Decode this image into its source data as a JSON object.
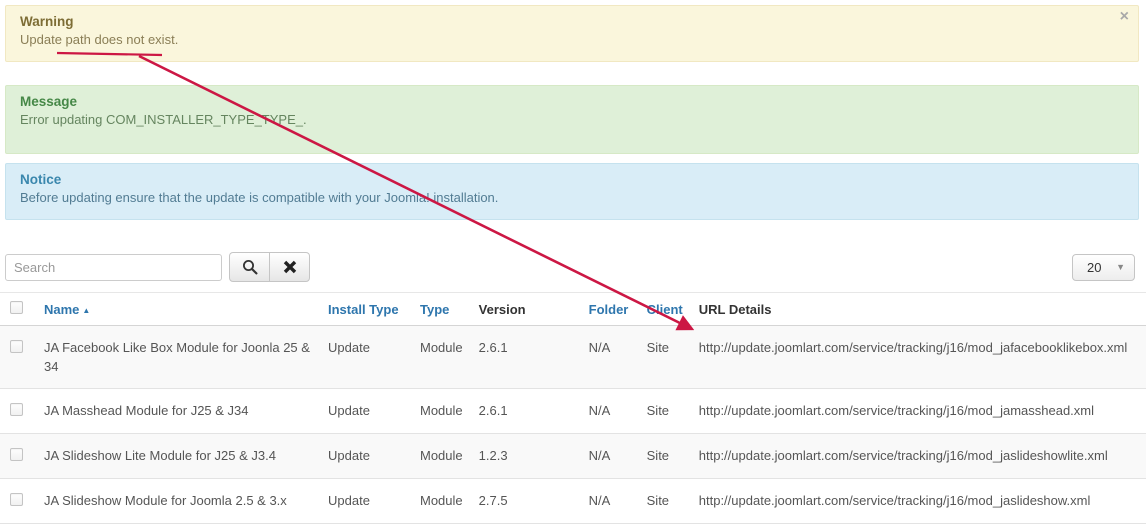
{
  "alerts": {
    "warning": {
      "heading": "Warning",
      "message_prefix": "Update ",
      "link_text": "path does not exist",
      "message_suffix": ".",
      "close_icon": "×"
    },
    "message": {
      "heading": "Message",
      "text": "Error updating COM_INSTALLER_TYPE_TYPE_."
    },
    "notice": {
      "heading": "Notice",
      "text": "Before updating ensure that the update is compatible with your Joomla! installation."
    }
  },
  "toolbar": {
    "search_placeholder": "Search",
    "search_value": "",
    "limit_value": "20",
    "limit_caret": "▼"
  },
  "table": {
    "headers": {
      "name": "Name",
      "sort_caret": "▲",
      "install_type": "Install Type",
      "type": "Type",
      "version": "Version",
      "folder": "Folder",
      "client": "Client",
      "url": "URL Details"
    },
    "rows": [
      {
        "name": "JA Facebook Like Box Module for Joonla 25 & 34",
        "install_type": "Update",
        "type": "Module",
        "version": "2.6.1",
        "folder": "N/A",
        "client": "Site",
        "url": "http://update.joomlart.com/service/tracking/j16/mod_jafacebooklikebox.xml"
      },
      {
        "name": "JA Masshead Module for J25 & J34",
        "install_type": "Update",
        "type": "Module",
        "version": "2.6.1",
        "folder": "N/A",
        "client": "Site",
        "url": "http://update.joomlart.com/service/tracking/j16/mod_jamasshead.xml"
      },
      {
        "name": "JA Slideshow Lite Module for J25 & J3.4",
        "install_type": "Update",
        "type": "Module",
        "version": "1.2.3",
        "folder": "N/A",
        "client": "Site",
        "url": "http://update.joomlart.com/service/tracking/j16/mod_jaslideshowlite.xml"
      },
      {
        "name": "JA Slideshow Module for Joomla 2.5 & 3.x",
        "install_type": "Update",
        "type": "Module",
        "version": "2.7.5",
        "folder": "N/A",
        "client": "Site",
        "url": "http://update.joomlart.com/service/tracking/j16/mod_jaslideshow.xml"
      }
    ]
  },
  "colors": {
    "link_blue": "#2e76ad",
    "annotation_red": "#cc1744",
    "warning_bg": "#faf6dc",
    "message_bg": "#dff0d8",
    "notice_bg": "#d9edf7"
  }
}
